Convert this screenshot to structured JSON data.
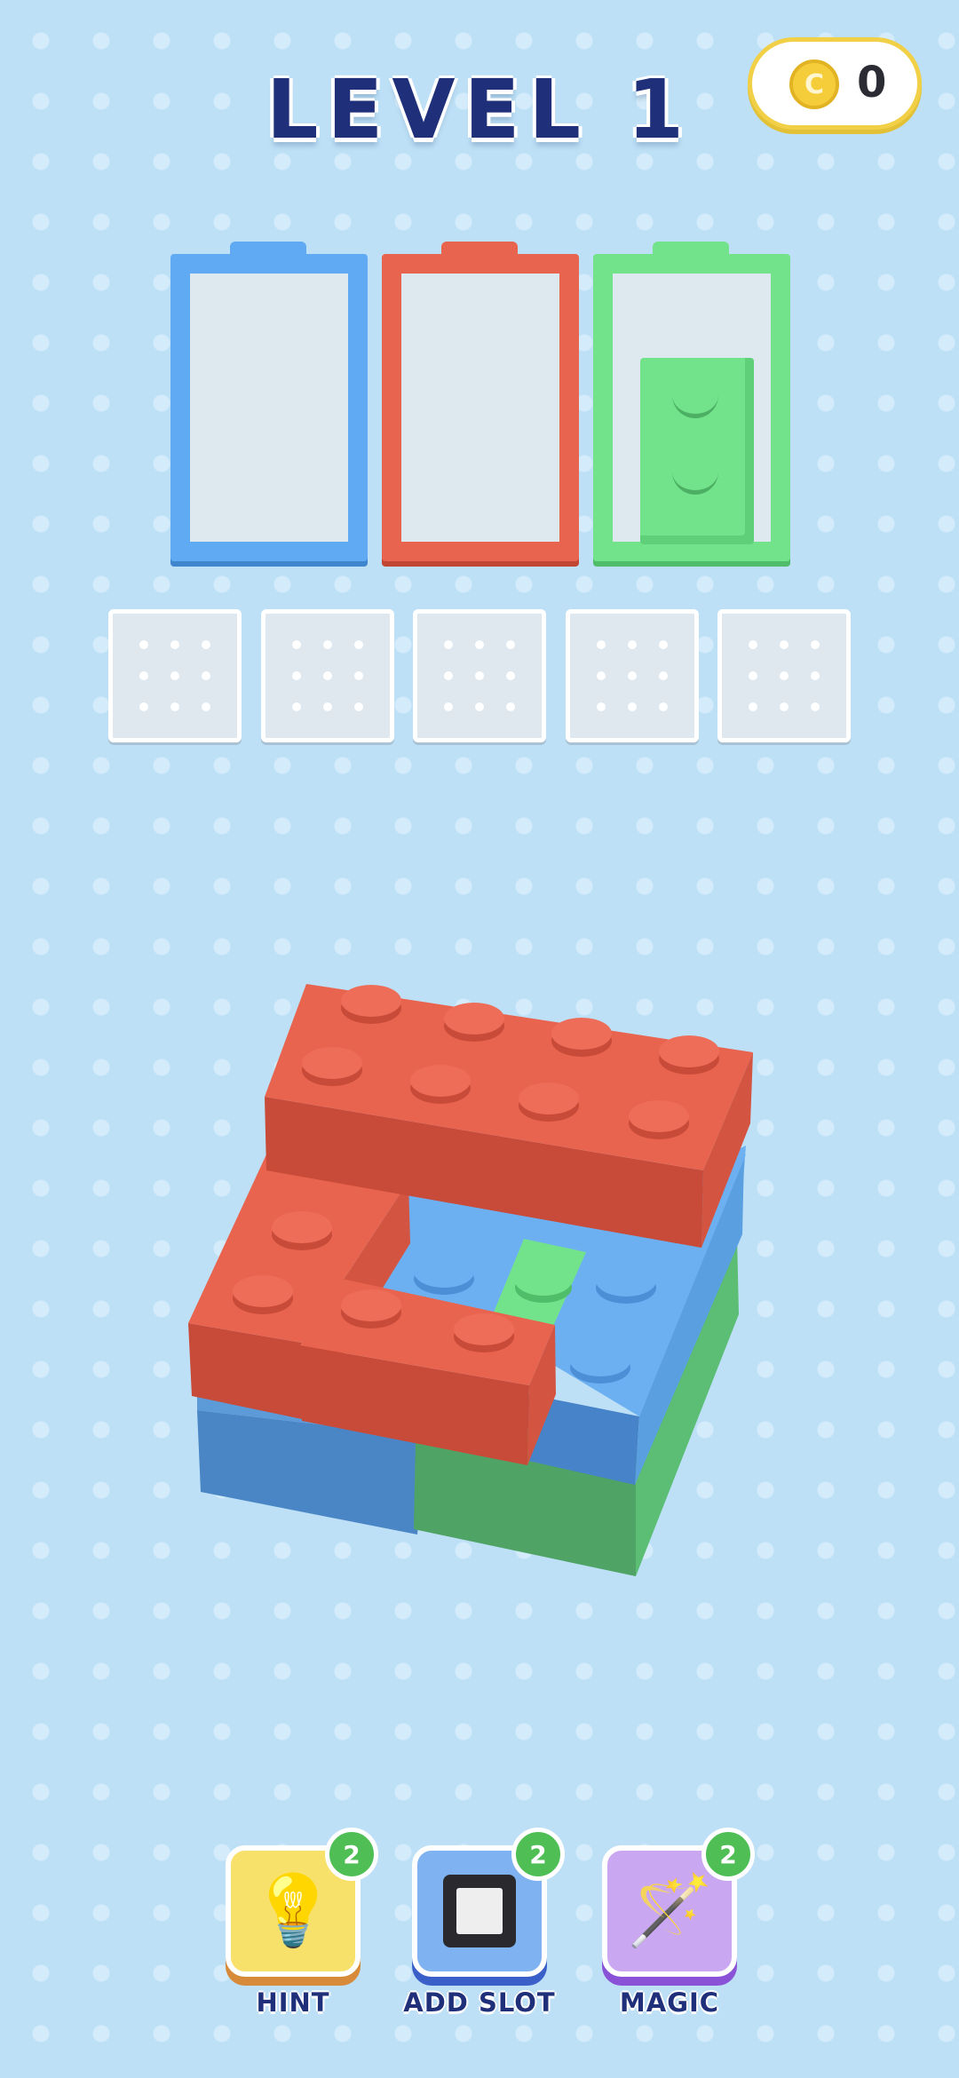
{
  "header": {
    "level_title": "LEVEL 1",
    "coin_symbol": "C",
    "coin_count": "0"
  },
  "colors": {
    "background": "#bde0f6",
    "blue": "#5faaf2",
    "red": "#e8644f",
    "green": "#72e38a",
    "title": "#1f2f7a"
  },
  "containers": [
    {
      "color": "blue",
      "filled_bricks": 0
    },
    {
      "color": "red",
      "filled_bricks": 0
    },
    {
      "color": "green",
      "filled_bricks": 1
    }
  ],
  "slots": {
    "count": 5,
    "occupied": 0
  },
  "boosters": [
    {
      "label": "HINT",
      "count": "2",
      "icon": "lightbulb-icon"
    },
    {
      "label": "ADD SLOT",
      "count": "2",
      "icon": "slot-square-icon"
    },
    {
      "label": "MAGIC",
      "count": "2",
      "icon": "magic-wand-icon"
    }
  ]
}
